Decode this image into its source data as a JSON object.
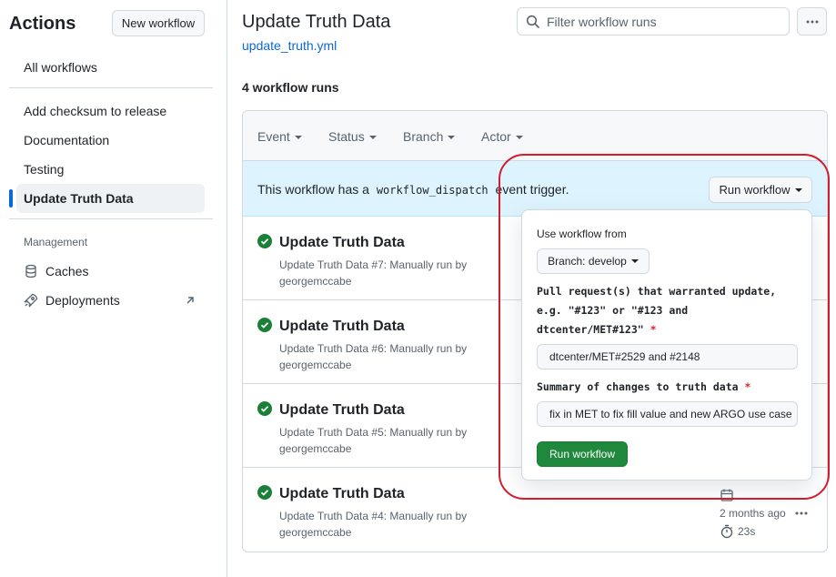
{
  "sidebar": {
    "title": "Actions",
    "new_workflow_label": "New workflow",
    "all_workflows": "All workflows",
    "items": [
      {
        "label": "Add checksum to release"
      },
      {
        "label": "Documentation"
      },
      {
        "label": "Testing"
      },
      {
        "label": "Update Truth Data",
        "active": true
      }
    ],
    "management_heading": "Management",
    "management_items": [
      {
        "label": "Caches",
        "icon": "database-icon"
      },
      {
        "label": "Deployments",
        "icon": "rocket-icon"
      }
    ]
  },
  "header": {
    "title": "Update Truth Data",
    "workflow_file": "update_truth.yml",
    "filter_placeholder": "Filter workflow runs"
  },
  "runs": {
    "count_label": "4 workflow runs",
    "filters": [
      "Event",
      "Status",
      "Branch",
      "Actor"
    ],
    "dispatch_text_before": "This workflow has a",
    "dispatch_code": "workflow_dispatch",
    "dispatch_text_after": "event trigger.",
    "run_workflow_label": "Run workflow",
    "items": [
      {
        "title": "Update Truth Data",
        "subtitle_name": "Update Truth Data",
        "subtitle_rest": "#7: Manually run by",
        "actor": "georgemccabe",
        "status": "success"
      },
      {
        "title": "Update Truth Data",
        "subtitle_name": "Update Truth Data",
        "subtitle_rest": "#6: Manually run by",
        "actor": "georgemccabe",
        "status": "success"
      },
      {
        "title": "Update Truth Data",
        "subtitle_name": "Update Truth Data",
        "subtitle_rest": "#5: Manually run by",
        "actor": "georgemccabe",
        "status": "success"
      },
      {
        "title": "Update Truth Data",
        "subtitle_name": "Update Truth Data",
        "subtitle_rest": "#4: Manually run by",
        "actor": "georgemccabe",
        "status": "success",
        "time_ago": "2 months ago",
        "duration": "23s"
      }
    ]
  },
  "dropdown": {
    "use_workflow_from": "Use workflow from",
    "branch_label": "Branch: develop",
    "q1_line1": "Pull request(s) that warranted update,",
    "q1_line2": "e.g. \"#123\" or \"#123 and",
    "q1_line3": "dtcenter/MET#123\"",
    "q1_value": "dtcenter/MET#2529 and #2148",
    "q2_label": "Summary of changes to truth data",
    "q2_value": "fix in MET to fix fill value and new ARGO use case",
    "required_mark": "*",
    "submit_label": "Run workflow"
  },
  "colors": {
    "accent": "#0969da",
    "success": "#1a7f37",
    "highlight": "#d31c2e",
    "dispatch_bg": "#ddf4ff"
  }
}
